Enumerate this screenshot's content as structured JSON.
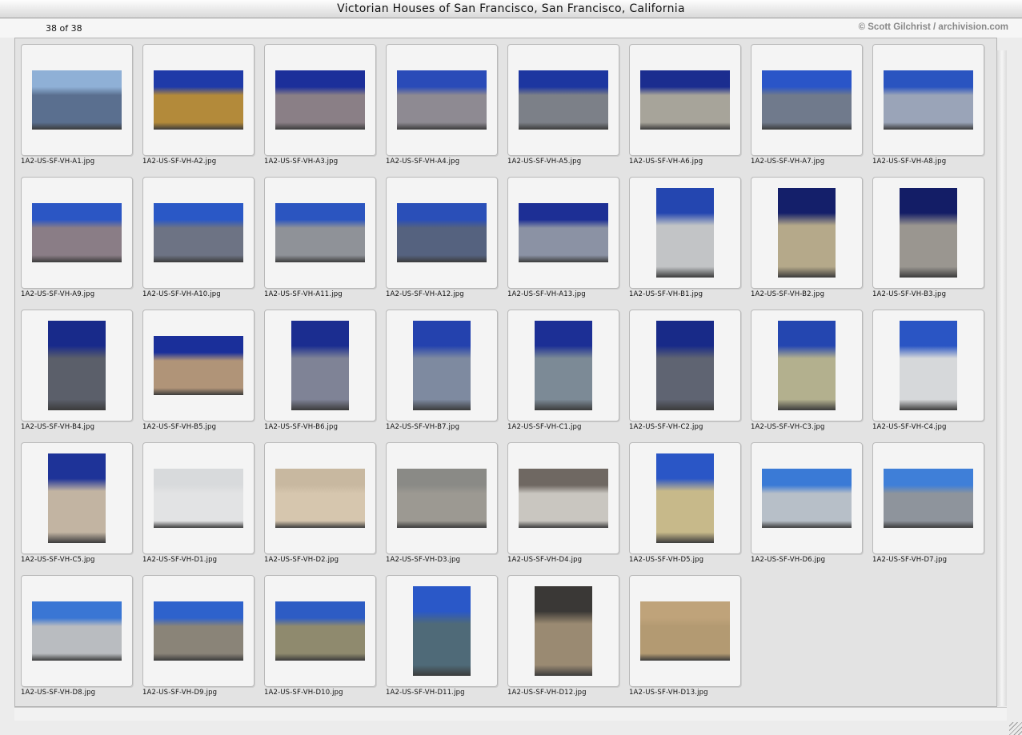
{
  "window": {
    "title": "Victorian Houses of San Francisco, San Francisco, California"
  },
  "header": {
    "count": "38 of 38",
    "credit": "© Scott Gilchrist / archivision.com"
  },
  "thumbnails": [
    {
      "file": "1A2-US-SF-VH-A1.jpg",
      "orientation": "landscape",
      "sky": "#8fb0d6",
      "body": "#5a6f8f"
    },
    {
      "file": "1A2-US-SF-VH-A2.jpg",
      "orientation": "landscape",
      "sky": "#1f3aa8",
      "body": "#b38a3a"
    },
    {
      "file": "1A2-US-SF-VH-A3.jpg",
      "orientation": "landscape",
      "sky": "#1c2f9a",
      "body": "#8a7f86"
    },
    {
      "file": "1A2-US-SF-VH-A4.jpg",
      "orientation": "landscape",
      "sky": "#2a4bb8",
      "body": "#8e8a92"
    },
    {
      "file": "1A2-US-SF-VH-A5.jpg",
      "orientation": "landscape",
      "sky": "#1d36a0",
      "body": "#7c8088"
    },
    {
      "file": "1A2-US-SF-VH-A6.jpg",
      "orientation": "landscape",
      "sky": "#1b2d8f",
      "body": "#a7a49a"
    },
    {
      "file": "1A2-US-SF-VH-A7.jpg",
      "orientation": "landscape",
      "sky": "#2a55c8",
      "body": "#707a8c"
    },
    {
      "file": "1A2-US-SF-VH-A8.jpg",
      "orientation": "landscape",
      "sky": "#2a54c0",
      "body": "#9aa4b8"
    },
    {
      "file": "1A2-US-SF-VH-A9.jpg",
      "orientation": "landscape",
      "sky": "#2b56c4",
      "body": "#8a7d86"
    },
    {
      "file": "1A2-US-SF-VH-A10.jpg",
      "orientation": "landscape",
      "sky": "#2a58c6",
      "body": "#6d7384"
    },
    {
      "file": "1A2-US-SF-VH-A11.jpg",
      "orientation": "landscape",
      "sky": "#2b55c0",
      "body": "#8f9298"
    },
    {
      "file": "1A2-US-SF-VH-A12.jpg",
      "orientation": "landscape",
      "sky": "#2a4fb8",
      "body": "#55627f"
    },
    {
      "file": "1A2-US-SF-VH-A13.jpg",
      "orientation": "landscape",
      "sky": "#1d2f95",
      "body": "#8b92a4"
    },
    {
      "file": "1A2-US-SF-VH-B1.jpg",
      "orientation": "portrait",
      "sky": "#2446b0",
      "body": "#c2c4c6"
    },
    {
      "file": "1A2-US-SF-VH-B2.jpg",
      "orientation": "portrait",
      "sky": "#141f6a",
      "body": "#b5a98a"
    },
    {
      "file": "1A2-US-SF-VH-B3.jpg",
      "orientation": "portrait",
      "sky": "#131d66",
      "body": "#9a9690"
    },
    {
      "file": "1A2-US-SF-VH-B4.jpg",
      "orientation": "portrait",
      "sky": "#182a8a",
      "body": "#5b5f6a"
    },
    {
      "file": "1A2-US-SF-VH-B5.jpg",
      "orientation": "landscape",
      "sky": "#1a2f9a",
      "body": "#b09478"
    },
    {
      "file": "1A2-US-SF-VH-B6.jpg",
      "orientation": "portrait",
      "sky": "#1b2d90",
      "body": "#7f8396"
    },
    {
      "file": "1A2-US-SF-VH-B7.jpg",
      "orientation": "portrait",
      "sky": "#2442ae",
      "body": "#7e8aa0"
    },
    {
      "file": "1A2-US-SF-VH-C1.jpg",
      "orientation": "portrait",
      "sky": "#1c2f95",
      "body": "#7c8a96"
    },
    {
      "file": "1A2-US-SF-VH-C2.jpg",
      "orientation": "portrait",
      "sky": "#182a88",
      "body": "#5f6472"
    },
    {
      "file": "1A2-US-SF-VH-C3.jpg",
      "orientation": "portrait",
      "sky": "#2446b0",
      "body": "#b3b08e"
    },
    {
      "file": "1A2-US-SF-VH-C4.jpg",
      "orientation": "portrait",
      "sky": "#2a55c4",
      "body": "#d6d8da"
    },
    {
      "file": "1A2-US-SF-VH-C5.jpg",
      "orientation": "portrait",
      "sky": "#1e3398",
      "body": "#c2b4a2"
    },
    {
      "file": "1A2-US-SF-VH-D1.jpg",
      "orientation": "landscape",
      "sky": "#d8dadc",
      "body": "#e2e3e4"
    },
    {
      "file": "1A2-US-SF-VH-D2.jpg",
      "orientation": "landscape",
      "sky": "#c8b8a0",
      "body": "#d6c6ae"
    },
    {
      "file": "1A2-US-SF-VH-D3.jpg",
      "orientation": "landscape",
      "sky": "#8a8a86",
      "body": "#9c9992"
    },
    {
      "file": "1A2-US-SF-VH-D4.jpg",
      "orientation": "landscape",
      "sky": "#6f6862",
      "body": "#c9c6c0"
    },
    {
      "file": "1A2-US-SF-VH-D5.jpg",
      "orientation": "portrait",
      "sky": "#2a56c6",
      "body": "#c7b98a"
    },
    {
      "file": "1A2-US-SF-VH-D6.jpg",
      "orientation": "landscape",
      "sky": "#3a7ad6",
      "body": "#b7bfc8"
    },
    {
      "file": "1A2-US-SF-VH-D7.jpg",
      "orientation": "landscape",
      "sky": "#3f7fd8",
      "body": "#8e949c"
    },
    {
      "file": "1A2-US-SF-VH-D8.jpg",
      "orientation": "landscape",
      "sky": "#3a76d4",
      "body": "#b9bcc0"
    },
    {
      "file": "1A2-US-SF-VH-D9.jpg",
      "orientation": "landscape",
      "sky": "#2e62cc",
      "body": "#8a8478"
    },
    {
      "file": "1A2-US-SF-VH-D10.jpg",
      "orientation": "landscape",
      "sky": "#2d5cc4",
      "body": "#8f8a6e"
    },
    {
      "file": "1A2-US-SF-VH-D11.jpg",
      "orientation": "portrait",
      "sky": "#2a58c8",
      "body": "#4f6a78"
    },
    {
      "file": "1A2-US-SF-VH-D12.jpg",
      "orientation": "portrait",
      "sky": "#3a3836",
      "body": "#9a8a72"
    },
    {
      "file": "1A2-US-SF-VH-D13.jpg",
      "orientation": "landscape",
      "sky": "#bfa37a",
      "body": "#b39a72"
    }
  ]
}
